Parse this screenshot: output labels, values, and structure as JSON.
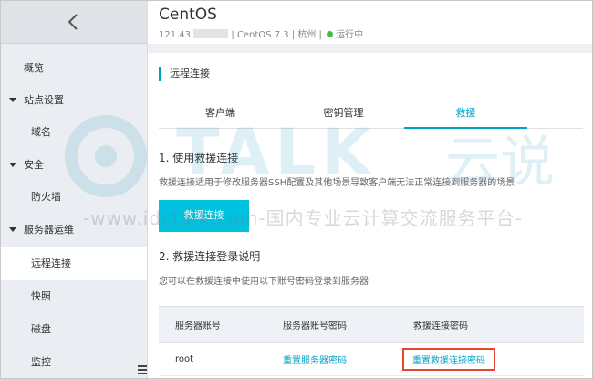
{
  "sidebar": {
    "items": [
      {
        "label": "概览",
        "kind": "top"
      },
      {
        "label": "站点设置",
        "kind": "group"
      },
      {
        "label": "域名",
        "kind": "sub"
      },
      {
        "label": "安全",
        "kind": "group"
      },
      {
        "label": "防火墙",
        "kind": "sub"
      },
      {
        "label": "服务器运维",
        "kind": "group"
      },
      {
        "label": "远程连接",
        "kind": "sub",
        "active": true
      },
      {
        "label": "快照",
        "kind": "sub"
      },
      {
        "label": "磁盘",
        "kind": "sub"
      },
      {
        "label": "监控",
        "kind": "sub"
      }
    ]
  },
  "header": {
    "title": "CentOS",
    "ip": "121.43.",
    "os": "| CentOS 7.3 | 杭州 |",
    "status": "运行中",
    "status_color": "#4cb848"
  },
  "section": {
    "title": "远程连接"
  },
  "tabs": [
    {
      "label": "客户端"
    },
    {
      "label": "密钥管理"
    },
    {
      "label": "救援",
      "active": true
    }
  ],
  "rescue": {
    "step1_title": "1. 使用救援连接",
    "step1_desc": "救援连接适用于修改服务器SSH配置及其他场景导致客户端无法正常连接到服务器的场景",
    "button_label": "救援连接",
    "step2_title": "2. 救援连接登录说明",
    "step2_desc": "您可以在救援连接中使用以下账号密码登录到服务器"
  },
  "table": {
    "headers": [
      "服务器账号",
      "服务器账号密码",
      "救援连接密码"
    ],
    "row": {
      "account": "root",
      "reset_server_pw": "重置服务器密码",
      "reset_rescue_pw": "重置救援连接密码"
    }
  },
  "watermark": {
    "brand": "TALK",
    "cloud": "云说",
    "url": "-www.idctalk.com-国内专业云计算交流服务平台-"
  },
  "colors": {
    "accent": "#00a2ca",
    "button": "#00c1de",
    "highlight_box": "#e4472f"
  }
}
